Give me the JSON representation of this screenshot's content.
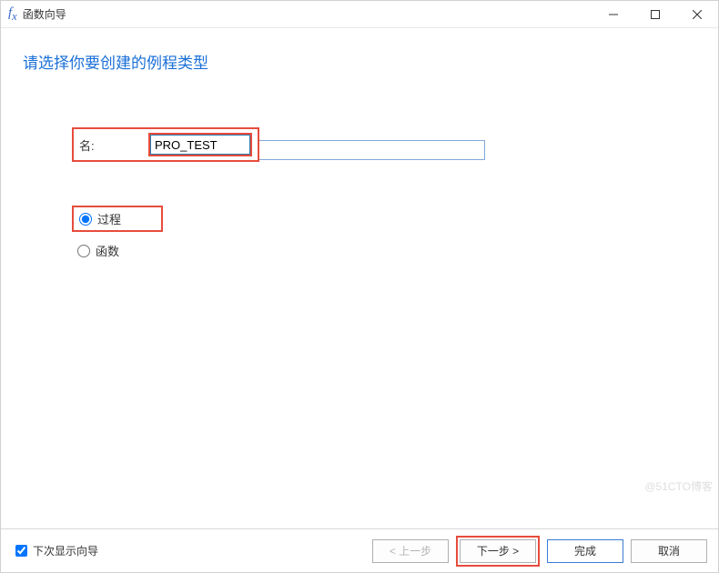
{
  "window": {
    "title": "函数向导"
  },
  "heading": "请选择你要创建的例程类型",
  "form": {
    "name_label": "名:",
    "name_value": "PRO_TEST",
    "radio_procedure": "过程",
    "radio_function": "函数"
  },
  "footer": {
    "show_next_time": "下次显示向导",
    "prev": "< 上一步",
    "next": "下一步 >",
    "finish": "完成",
    "cancel": "取消"
  },
  "watermark": "@51CTO博客"
}
